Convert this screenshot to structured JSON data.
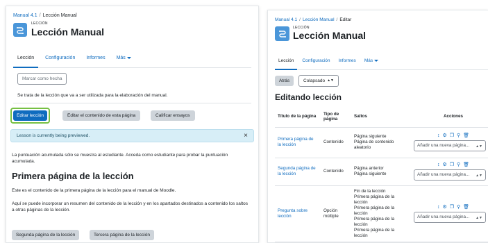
{
  "left": {
    "breadcrumb": {
      "course": "Manual 4.1",
      "separator": "/",
      "current": "Lección Manual"
    },
    "kicker": "LECCIÓN",
    "title": "Lección Manual",
    "tabs": {
      "leccion": "Lección",
      "configuracion": "Configuración",
      "informes": "Informes",
      "mas": "Más"
    },
    "mark_done": "Marcar como hecha",
    "lesson_description": "Se trata de la lección que va a ser utilizada para la elaboración del manual.",
    "buttons": {
      "edit_lesson": "Editar lección",
      "edit_page_content": "Editar el contenido de esta página",
      "grade_essays": "Calificar ensayos"
    },
    "alert": {
      "text": "Lesson is currently being previewed.",
      "close": "×"
    },
    "score_note": "La puntuación acumulada sólo se muestra al estudiante. Acceda como estudiante para probar la puntuación acumulada.",
    "page_title": "Primera página de la lección",
    "page_para1": "Este es el contenido de la primera página de la lección para el manual de Moodle.",
    "page_para2": "Aquí se puede incorporar un resumen del contenido de la lección y en los apartados destinados a contenido los saltos a otras páginas de la lección.",
    "next_buttons": {
      "second": "Segunda página de la lección",
      "third": "Tercera página de la lección"
    }
  },
  "right": {
    "breadcrumb": {
      "course": "Manual 4.1",
      "lesson": "Lección Manual",
      "current": "Editar",
      "separator": "/"
    },
    "kicker": "LECCIÓN",
    "title": "Lección Manual",
    "tabs": {
      "leccion": "Lección",
      "configuracion": "Configuración",
      "informes": "Informes",
      "mas": "Más"
    },
    "back_button": "Atrás",
    "view_select": "Colapsado",
    "edit_heading": "Editando lección",
    "table": {
      "headers": {
        "title": "Título de la página",
        "type": "Tipo de página",
        "jumps": "Saltos",
        "actions": "Acciones"
      },
      "add_page_placeholder": "Añadir una nueva página...",
      "rows": [
        {
          "title": "Primera página de la lección",
          "type": "Contenido",
          "jumps": [
            "Página siguiente",
            "Página de contenido aleatorio"
          ]
        },
        {
          "title": "Segunda página de la lección",
          "type": "Contenido",
          "jumps": [
            "Página anterior",
            "Página siguiente"
          ]
        },
        {
          "title": "Pregunta sobre lección",
          "type": "Opción múltiple",
          "jumps": [
            "Fin de la lección",
            "Primera página de la lección",
            "Primera página de la lección",
            "Primera página de la lección",
            "Primera página de la lección"
          ]
        }
      ]
    }
  },
  "icons": {
    "activity": "lesson-icon",
    "move": "move-icon",
    "settings": "gear-icon",
    "copy": "copy-icon",
    "preview": "zoom-icon",
    "delete": "trash-icon",
    "dropdown": "caret-down-icon"
  },
  "colors": {
    "link": "#0f6cbf",
    "focus_ring": "#76c043",
    "alert_bg": "#d7eef7",
    "icon_bg": "#4a96d9"
  }
}
